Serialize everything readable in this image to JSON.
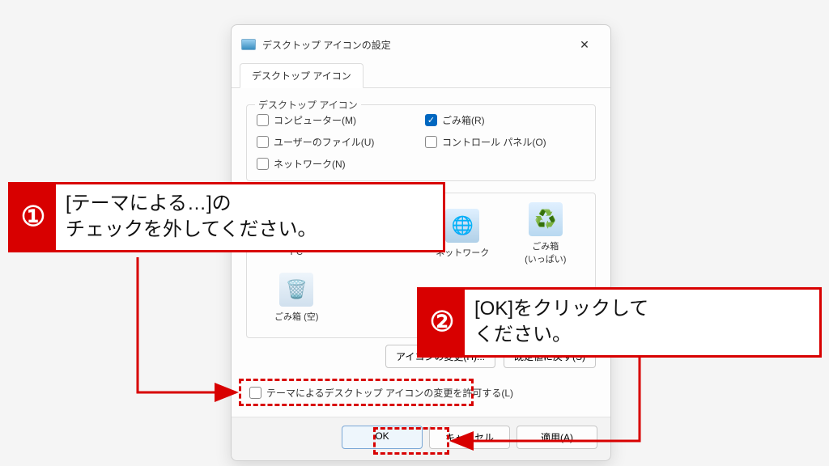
{
  "dialog": {
    "title": "デスクトップ アイコンの設定",
    "close_label": "✕",
    "tab_label": "デスクトップ アイコン",
    "group_title": "デスクトップ アイコン",
    "checkboxes": {
      "computer": {
        "label": "コンピューター(M)",
        "checked": false
      },
      "recycle": {
        "label": "ごみ箱(R)",
        "checked": true
      },
      "userfiles": {
        "label": "ユーザーのファイル(U)",
        "checked": false
      },
      "controlpanel": {
        "label": "コントロール パネル(O)",
        "checked": false
      },
      "network": {
        "label": "ネットワーク(N)",
        "checked": false
      }
    },
    "preview": {
      "pc": "PC",
      "userfiles": "",
      "network": "ネットワーク",
      "recycle_full": "ごみ箱\n(いっぱい)",
      "recycle_empty": "ごみ箱 (空)"
    },
    "change_icon_btn": "アイコンの変更(H)...",
    "restore_default_btn": "既定値に戻す(S)",
    "theme_allow_label": "テーマによるデスクトップ アイコンの変更を許可する(L)",
    "theme_allow_checked": false,
    "footer": {
      "ok": "OK",
      "cancel": "キャンセル",
      "apply": "適用(A)"
    }
  },
  "annotations": {
    "step1": {
      "num": "①",
      "text": "[テーマによる…]の\nチェックを外してください。"
    },
    "step2": {
      "num": "②",
      "text": "[OK]をクリックして\nください。"
    }
  },
  "colors": {
    "accent_red": "#d80000",
    "win_blue": "#0067c0"
  }
}
